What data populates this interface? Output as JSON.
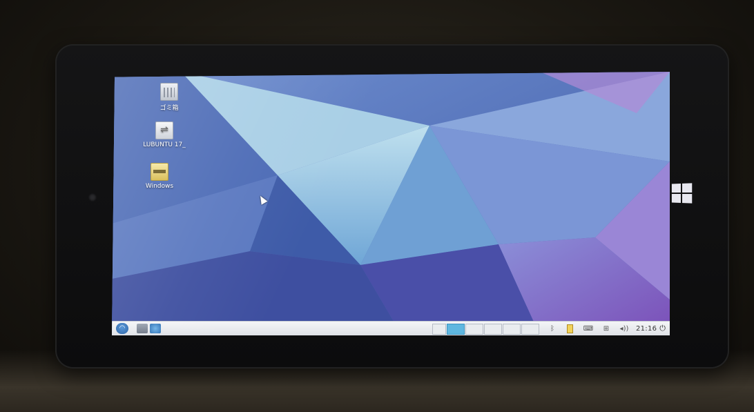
{
  "desktop": {
    "icons": [
      {
        "label": "ゴミ箱",
        "icon": "trash-icon"
      },
      {
        "label": "LUBUNTU 17_",
        "icon": "usb-drive-icon"
      },
      {
        "label": "Windows",
        "icon": "disk-drive-icon"
      }
    ]
  },
  "taskbar": {
    "start_icon": "lxde-menu-icon",
    "quick_launch": [
      "file-manager-icon",
      "web-browser-icon"
    ],
    "desktops": 6,
    "active_desktop": 1,
    "tray": [
      "bluetooth-icon",
      "battery-icon",
      "keyboard-icon",
      "network-icon",
      "volume-icon"
    ],
    "clock": "21:16",
    "power_glyph": "⏻",
    "volume_glyph": "◂))"
  },
  "hardware": {
    "windows_button": "windows-logo-icon"
  }
}
